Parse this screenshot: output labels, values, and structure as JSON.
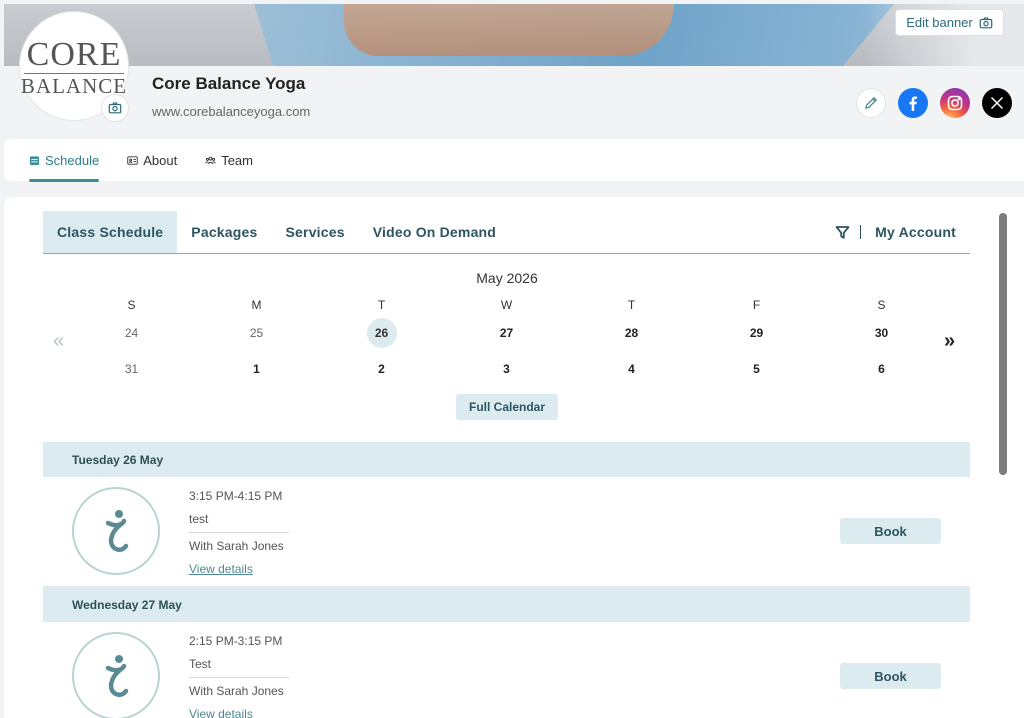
{
  "banner": {
    "edit_label": "Edit banner"
  },
  "logo": {
    "line1": "CORE",
    "line2": "BALANCE"
  },
  "business": {
    "name": "Core Balance Yoga",
    "url": "www.corebalanceyoga.com"
  },
  "social": [
    "pencil-icon",
    "facebook-icon",
    "instagram-icon",
    "x-icon"
  ],
  "top_tabs": [
    {
      "label": "Schedule",
      "icon": "calendar-icon",
      "active": true
    },
    {
      "label": "About",
      "icon": "id-card-icon"
    },
    {
      "label": "Team",
      "icon": "team-icon"
    }
  ],
  "subnav": {
    "tabs": [
      {
        "label": "Class Schedule",
        "active": true
      },
      {
        "label": "Packages"
      },
      {
        "label": "Services"
      },
      {
        "label": "Video On Demand"
      }
    ],
    "account_label": "My Account"
  },
  "calendar": {
    "month": "May 2026",
    "weekdays": [
      "S",
      "M",
      "T",
      "W",
      "T",
      "F",
      "S"
    ],
    "week1": [
      "24",
      "25",
      "26",
      "27",
      "28",
      "29",
      "30"
    ],
    "week2": [
      "31",
      "1",
      "2",
      "3",
      "4",
      "5",
      "6"
    ],
    "selected": "26",
    "prev_arrow": "«",
    "next_arrow": "»",
    "full_calendar_label": "Full Calendar"
  },
  "days": [
    {
      "heading": "Tuesday 26 May",
      "class": {
        "time": "3:15 PM-4:15 PM",
        "name": "test",
        "teacher": "With Sarah Jones",
        "details_label": "View details",
        "book_label": "Book"
      }
    },
    {
      "heading": "Wednesday 27 May",
      "class": {
        "time": "2:15 PM-3:15 PM",
        "name": "Test",
        "teacher": "With Sarah Jones",
        "details_label": "View details",
        "book_label": "Book"
      }
    }
  ],
  "colors": {
    "accent": "#2e7d89",
    "light_accent": "#dcebef",
    "text_dark": "#2c5560"
  }
}
